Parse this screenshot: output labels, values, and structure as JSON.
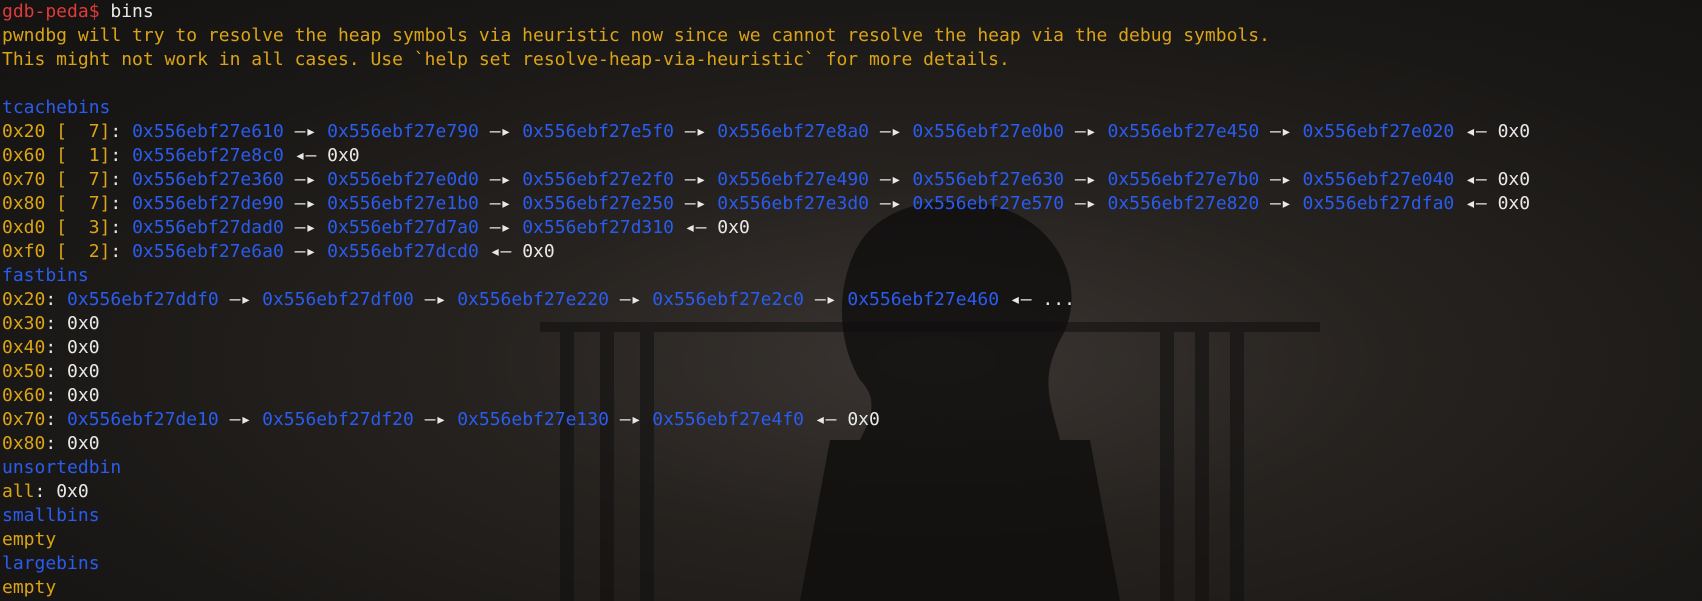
{
  "colors": {
    "prompt": "#e03a3a",
    "yellow": "#dba416",
    "blue": "#2a5cf0",
    "white": "#e8e8e8",
    "background": "#1e1c1a"
  },
  "lines": [
    [
      {
        "t": "gdb-peda$",
        "c": "p-red"
      },
      {
        "t": " bins",
        "c": "white"
      }
    ],
    [
      {
        "t": "pwndbg will try to resolve the heap symbols via heuristic now since we cannot resolve the heap via the debug symbols.",
        "c": "yellow"
      }
    ],
    [
      {
        "t": "This might not work in all cases. Use `help set resolve-heap-via-heuristic` for more details.",
        "c": "yellow"
      }
    ],
    [],
    [
      {
        "t": "tcachebins",
        "c": "blue"
      }
    ],
    [
      {
        "t": "0x20 [  7]",
        "c": "yellow"
      },
      {
        "t": ": ",
        "c": "white"
      },
      {
        "t": "0x556ebf27e610",
        "c": "blue"
      },
      {
        "t": " —▸ ",
        "c": "white"
      },
      {
        "t": "0x556ebf27e790",
        "c": "blue"
      },
      {
        "t": " —▸ ",
        "c": "white"
      },
      {
        "t": "0x556ebf27e5f0",
        "c": "blue"
      },
      {
        "t": " —▸ ",
        "c": "white"
      },
      {
        "t": "0x556ebf27e8a0",
        "c": "blue"
      },
      {
        "t": " —▸ ",
        "c": "white"
      },
      {
        "t": "0x556ebf27e0b0",
        "c": "blue"
      },
      {
        "t": " —▸ ",
        "c": "white"
      },
      {
        "t": "0x556ebf27e450",
        "c": "blue"
      },
      {
        "t": " —▸ ",
        "c": "white"
      },
      {
        "t": "0x556ebf27e020",
        "c": "blue"
      },
      {
        "t": " ◂— 0x0",
        "c": "white"
      }
    ],
    [
      {
        "t": "0x60 [  1]",
        "c": "yellow"
      },
      {
        "t": ": ",
        "c": "white"
      },
      {
        "t": "0x556ebf27e8c0",
        "c": "blue"
      },
      {
        "t": " ◂— 0x0",
        "c": "white"
      }
    ],
    [
      {
        "t": "0x70 [  7]",
        "c": "yellow"
      },
      {
        "t": ": ",
        "c": "white"
      },
      {
        "t": "0x556ebf27e360",
        "c": "blue"
      },
      {
        "t": " —▸ ",
        "c": "white"
      },
      {
        "t": "0x556ebf27e0d0",
        "c": "blue"
      },
      {
        "t": " —▸ ",
        "c": "white"
      },
      {
        "t": "0x556ebf27e2f0",
        "c": "blue"
      },
      {
        "t": " —▸ ",
        "c": "white"
      },
      {
        "t": "0x556ebf27e490",
        "c": "blue"
      },
      {
        "t": " —▸ ",
        "c": "white"
      },
      {
        "t": "0x556ebf27e630",
        "c": "blue"
      },
      {
        "t": " —▸ ",
        "c": "white"
      },
      {
        "t": "0x556ebf27e7b0",
        "c": "blue"
      },
      {
        "t": " —▸ ",
        "c": "white"
      },
      {
        "t": "0x556ebf27e040",
        "c": "blue"
      },
      {
        "t": " ◂— 0x0",
        "c": "white"
      }
    ],
    [
      {
        "t": "0x80 [  7]",
        "c": "yellow"
      },
      {
        "t": ": ",
        "c": "white"
      },
      {
        "t": "0x556ebf27de90",
        "c": "blue"
      },
      {
        "t": " —▸ ",
        "c": "white"
      },
      {
        "t": "0x556ebf27e1b0",
        "c": "blue"
      },
      {
        "t": " —▸ ",
        "c": "white"
      },
      {
        "t": "0x556ebf27e250",
        "c": "blue"
      },
      {
        "t": " —▸ ",
        "c": "white"
      },
      {
        "t": "0x556ebf27e3d0",
        "c": "blue"
      },
      {
        "t": " —▸ ",
        "c": "white"
      },
      {
        "t": "0x556ebf27e570",
        "c": "blue"
      },
      {
        "t": " —▸ ",
        "c": "white"
      },
      {
        "t": "0x556ebf27e820",
        "c": "blue"
      },
      {
        "t": " —▸ ",
        "c": "white"
      },
      {
        "t": "0x556ebf27dfa0",
        "c": "blue"
      },
      {
        "t": " ◂— 0x0",
        "c": "white"
      }
    ],
    [
      {
        "t": "0xd0 [  3]",
        "c": "yellow"
      },
      {
        "t": ": ",
        "c": "white"
      },
      {
        "t": "0x556ebf27dad0",
        "c": "blue"
      },
      {
        "t": " —▸ ",
        "c": "white"
      },
      {
        "t": "0x556ebf27d7a0",
        "c": "blue"
      },
      {
        "t": " —▸ ",
        "c": "white"
      },
      {
        "t": "0x556ebf27d310",
        "c": "blue"
      },
      {
        "t": " ◂— 0x0",
        "c": "white"
      }
    ],
    [
      {
        "t": "0xf0 [  2]",
        "c": "yellow"
      },
      {
        "t": ": ",
        "c": "white"
      },
      {
        "t": "0x556ebf27e6a0",
        "c": "blue"
      },
      {
        "t": " —▸ ",
        "c": "white"
      },
      {
        "t": "0x556ebf27dcd0",
        "c": "blue"
      },
      {
        "t": " ◂— 0x0",
        "c": "white"
      }
    ],
    [
      {
        "t": "fastbins",
        "c": "blue"
      }
    ],
    [
      {
        "t": "0x20",
        "c": "yellow"
      },
      {
        "t": ": ",
        "c": "white"
      },
      {
        "t": "0x556ebf27ddf0",
        "c": "blue"
      },
      {
        "t": " —▸ ",
        "c": "white"
      },
      {
        "t": "0x556ebf27df00",
        "c": "blue"
      },
      {
        "t": " —▸ ",
        "c": "white"
      },
      {
        "t": "0x556ebf27e220",
        "c": "blue"
      },
      {
        "t": " —▸ ",
        "c": "white"
      },
      {
        "t": "0x556ebf27e2c0",
        "c": "blue"
      },
      {
        "t": " —▸ ",
        "c": "white"
      },
      {
        "t": "0x556ebf27e460",
        "c": "blue"
      },
      {
        "t": " ◂— ...",
        "c": "white"
      }
    ],
    [
      {
        "t": "0x30",
        "c": "yellow"
      },
      {
        "t": ": 0x0",
        "c": "white"
      }
    ],
    [
      {
        "t": "0x40",
        "c": "yellow"
      },
      {
        "t": ": 0x0",
        "c": "white"
      }
    ],
    [
      {
        "t": "0x50",
        "c": "yellow"
      },
      {
        "t": ": 0x0",
        "c": "white"
      }
    ],
    [
      {
        "t": "0x60",
        "c": "yellow"
      },
      {
        "t": ": 0x0",
        "c": "white"
      }
    ],
    [
      {
        "t": "0x70",
        "c": "yellow"
      },
      {
        "t": ": ",
        "c": "white"
      },
      {
        "t": "0x556ebf27de10",
        "c": "blue"
      },
      {
        "t": " —▸ ",
        "c": "white"
      },
      {
        "t": "0x556ebf27df20",
        "c": "blue"
      },
      {
        "t": " —▸ ",
        "c": "white"
      },
      {
        "t": "0x556ebf27e130",
        "c": "blue"
      },
      {
        "t": " —▸ ",
        "c": "white"
      },
      {
        "t": "0x556ebf27e4f0",
        "c": "blue"
      },
      {
        "t": " ◂— 0x0",
        "c": "white"
      }
    ],
    [
      {
        "t": "0x80",
        "c": "yellow"
      },
      {
        "t": ": 0x0",
        "c": "white"
      }
    ],
    [
      {
        "t": "unsortedbin",
        "c": "blue"
      }
    ],
    [
      {
        "t": "all",
        "c": "yellow"
      },
      {
        "t": ": 0x0",
        "c": "white"
      }
    ],
    [
      {
        "t": "smallbins",
        "c": "blue"
      }
    ],
    [
      {
        "t": "empty",
        "c": "yellow"
      }
    ],
    [
      {
        "t": "largebins",
        "c": "blue"
      }
    ],
    [
      {
        "t": "empty",
        "c": "yellow"
      }
    ]
  ]
}
